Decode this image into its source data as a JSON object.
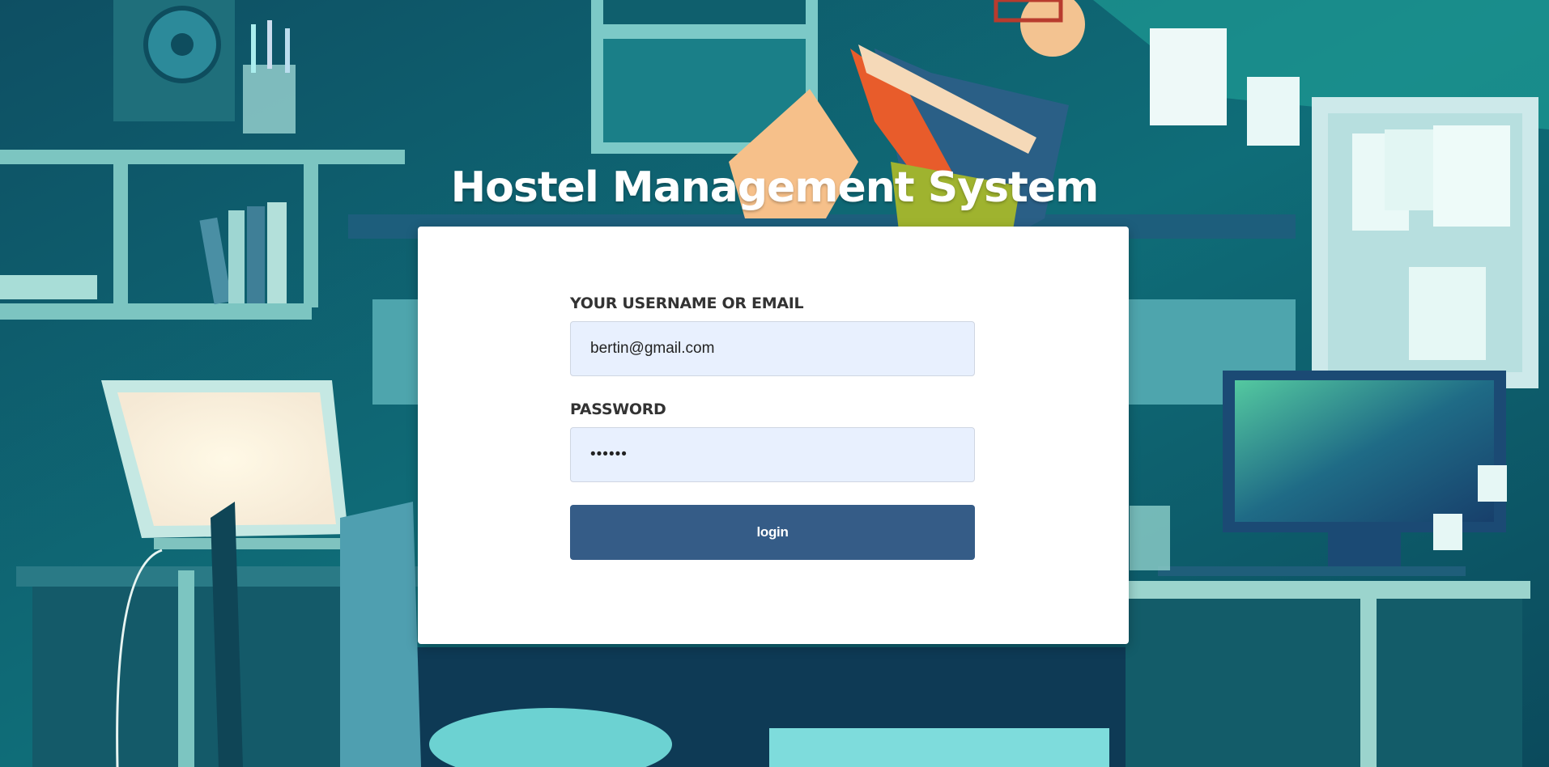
{
  "page": {
    "title": "Hostel Management System"
  },
  "login_form": {
    "username_label": "YOUR USERNAME OR EMAIL",
    "username_value": "bertin@gmail.com",
    "password_label": "PASSWORD",
    "password_value": "••••••",
    "submit_label": "login"
  },
  "colors": {
    "button": "#355c87",
    "input_background": "#e8f0fe",
    "background": "#0d5d6a"
  }
}
